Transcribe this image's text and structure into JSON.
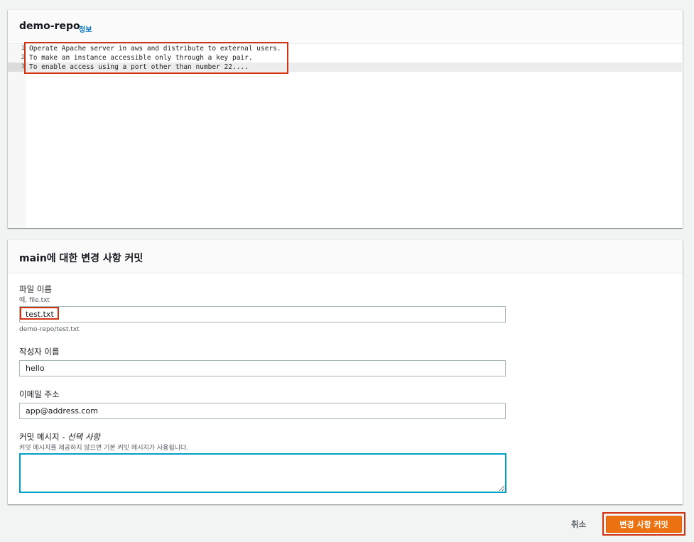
{
  "editor": {
    "title": "demo-repo",
    "info_link": "정보",
    "line_numbers": [
      "1",
      "2",
      "3"
    ],
    "lines": [
      "Operate Apache server in aws and distribute to external users.",
      "To make an instance accessible only through a key pair.",
      "To enable access using a port other than number 22...."
    ]
  },
  "commit": {
    "title": "main에 대한 변경 사항 커밋",
    "file_name": {
      "label": "파일 이름",
      "hint": "예, file.txt",
      "value": "test.txt",
      "path": "demo-repo/test.txt"
    },
    "author_name": {
      "label": "작성자 이름",
      "value": "hello"
    },
    "email": {
      "label": "이메일 주소",
      "value": "app@address.com"
    },
    "message": {
      "label": "커밋 메시지 - ",
      "optional": "선택 사항",
      "hint": "커밋 메시지를 제공하지 않으면 기본 커밋 메시지가 사용됩니다.",
      "value": ""
    }
  },
  "footer": {
    "cancel": "취소",
    "commit_button": "변경 사항 커밋"
  },
  "colors": {
    "accent": "#ec7211",
    "highlight": "#d13212",
    "link": "#0073bb",
    "focus": "#00a1c9"
  }
}
